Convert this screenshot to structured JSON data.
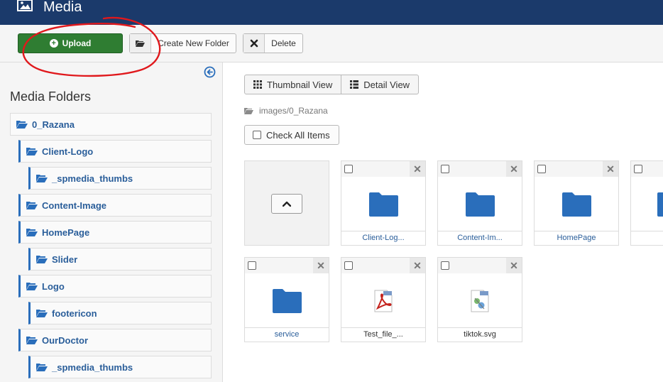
{
  "header": {
    "title": "Media",
    "icon": "image-icon"
  },
  "toolbar": {
    "upload_label": "Upload",
    "new_folder_label": "Create New Folder",
    "delete_label": "Delete"
  },
  "sidebar": {
    "heading": "Media Folders",
    "folders": [
      {
        "label": "0_Razana",
        "level": 0
      },
      {
        "label": "Client-Logo",
        "level": 1
      },
      {
        "label": "_spmedia_thumbs",
        "level": 2
      },
      {
        "label": "Content-Image",
        "level": 1
      },
      {
        "label": "HomePage",
        "level": 1
      },
      {
        "label": "Slider",
        "level": 2
      },
      {
        "label": "Logo",
        "level": 1
      },
      {
        "label": "footericon",
        "level": 2
      },
      {
        "label": "OurDoctor",
        "level": 1
      },
      {
        "label": "_spmedia_thumbs",
        "level": 2
      }
    ]
  },
  "main": {
    "thumbnail_view_label": "Thumbnail View",
    "detail_view_label": "Detail View",
    "breadcrumb": "images/0_Razana",
    "check_all_label": "Check All Items",
    "items": [
      {
        "name": "Client-Log...",
        "type": "folder"
      },
      {
        "name": "Content-Im...",
        "type": "folder"
      },
      {
        "name": "HomePage",
        "type": "folder"
      },
      {
        "name": "",
        "type": "folder"
      },
      {
        "name": "service",
        "type": "folder"
      },
      {
        "name": "Test_file_...",
        "type": "pdf"
      },
      {
        "name": "tiktok.svg",
        "type": "svg"
      }
    ]
  },
  "colors": {
    "header_bg": "#1b3a6b",
    "upload_bg": "#2f7d32",
    "folder_blue": "#2a6ebb",
    "annotation_red": "#e0181c"
  }
}
